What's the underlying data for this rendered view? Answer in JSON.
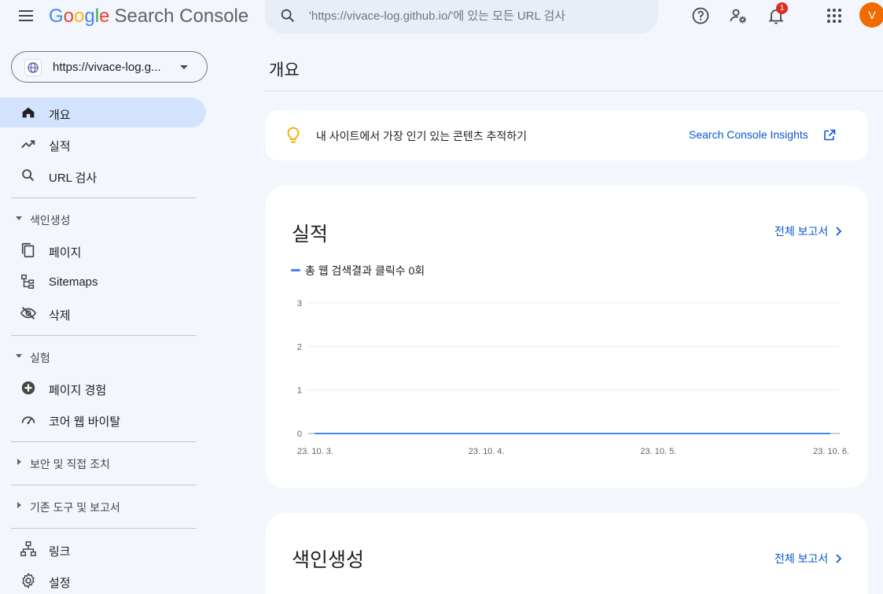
{
  "header": {
    "logo_google": [
      "G",
      "o",
      "o",
      "g",
      "l",
      "e"
    ],
    "product": "Search Console",
    "search_placeholder": "'https://vivace-log.github.io/'에 있는 모든 URL 검사",
    "notification_count": "1",
    "avatar_initial": "V"
  },
  "sidebar": {
    "property_url": "https://vivace-log.g...",
    "items_top": [
      {
        "label": "개요",
        "icon": "home-icon",
        "active": true
      },
      {
        "label": "실적",
        "icon": "trending-up-icon"
      },
      {
        "label": "URL 검사",
        "icon": "search-icon"
      }
    ],
    "sections": {
      "indexing": {
        "label": "색인생성",
        "expanded": true,
        "items": [
          {
            "label": "페이지",
            "icon": "pages-icon"
          },
          {
            "label": "Sitemaps",
            "icon": "sitemap-icon"
          },
          {
            "label": "삭제",
            "icon": "visibility-off-icon"
          }
        ]
      },
      "experience": {
        "label": "실험",
        "expanded": true,
        "items": [
          {
            "label": "페이지 경험",
            "icon": "add-circle-icon"
          },
          {
            "label": "코어 웹 바이탈",
            "icon": "speedometer-icon"
          }
        ]
      },
      "security": {
        "label": "보안 및 직접 조치",
        "expanded": false
      },
      "legacy": {
        "label": "기존 도구 및 보고서",
        "expanded": false
      }
    },
    "items_bottom": [
      {
        "label": "링크",
        "icon": "links-icon"
      },
      {
        "label": "설정",
        "icon": "settings-icon"
      }
    ]
  },
  "main": {
    "page_title": "개요",
    "insights": {
      "message": "내 사이트에서 가장 인기 있는 콘텐츠 추적하기",
      "link": "Search Console Insights"
    },
    "performance": {
      "title": "실적",
      "full_report": "전체 보고서",
      "legend": "총 웹 검색결과 클릭수 0회"
    },
    "indexing": {
      "title": "색인생성",
      "full_report": "전체 보고서"
    }
  },
  "colors": {
    "accent": "#0b57d0",
    "active_bg": "#d3e3fd",
    "series": "#4285f4",
    "avatar": "#ef6c00"
  },
  "chart_data": {
    "type": "line",
    "x": [
      "23. 10. 3.",
      "23. 10. 4.",
      "23. 10. 5.",
      "23. 10. 6."
    ],
    "series": [
      {
        "name": "총 웹 검색결과 클릭수 0회",
        "values": [
          0,
          0,
          0,
          0
        ]
      }
    ],
    "y_ticks": [
      0,
      1,
      2,
      3
    ],
    "ylim": [
      0,
      3
    ],
    "grid": true
  }
}
